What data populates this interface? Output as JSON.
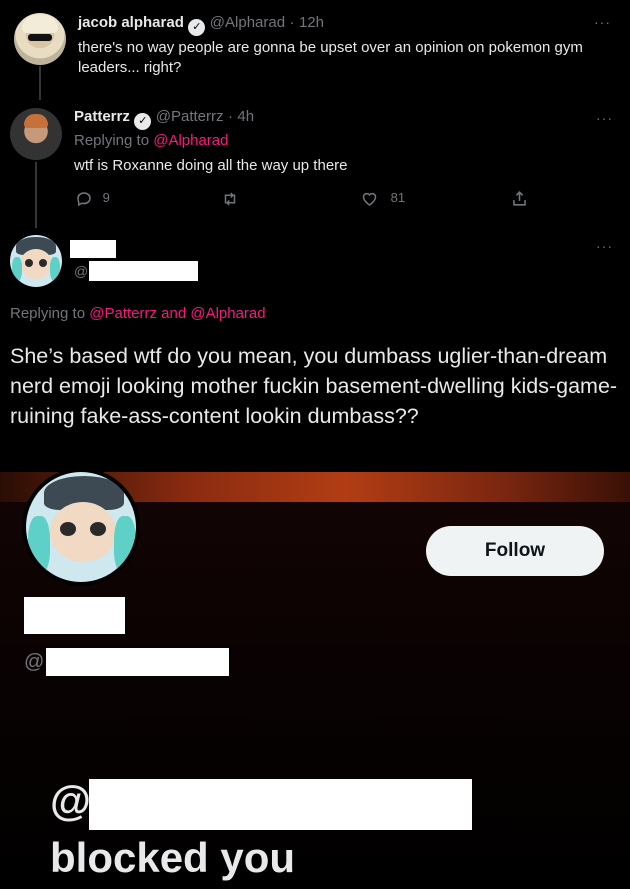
{
  "tweet1": {
    "name": "jacob alpharad",
    "handle": "@Alpharad",
    "separator": "·",
    "time": "12h",
    "text": "there's no way people are gonna be upset over an opinion on pokemon gym leaders... right?"
  },
  "tweet2": {
    "name": "Patterrz",
    "handle": "@Patterrz",
    "separator": "·",
    "time": "4h",
    "replying_prefix": "Replying to",
    "replying_to": "@Alpharad",
    "text": "wtf is Roxanne doing all the way up there",
    "reply_count": "9",
    "like_count": "81"
  },
  "tweet3": {
    "handle_prefix": "@",
    "replying_prefix": "Replying to",
    "replying_to_1": "@Patterrz",
    "replying_and": "and",
    "replying_to_2": "@Alpharad",
    "text": "She’s based wtf do you mean, you dumbass uglier-than-dream nerd emoji looking mother fuckin basement-dwelling kids-game-ruining fake-ass-content lookin dumbass??"
  },
  "profile": {
    "follow_label": "Follow",
    "handle_prefix": "@"
  },
  "blocked": {
    "prefix": "@",
    "message": "blocked you"
  },
  "colors": {
    "background": "#000000",
    "link": "#f91880",
    "muted": "#71767b",
    "text": "#e7e9ea"
  },
  "icons": [
    "verified-icon",
    "more-icon",
    "reply-icon",
    "retweet-icon",
    "like-icon",
    "share-icon"
  ]
}
